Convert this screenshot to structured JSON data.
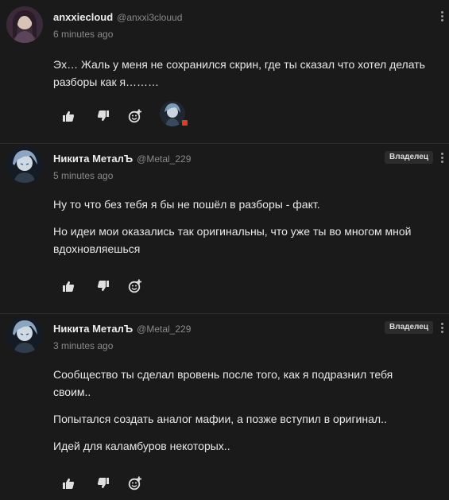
{
  "comments": [
    {
      "author": "anxxiecloud",
      "handle": "@anxxi3clouud",
      "time": "6 minutes ago",
      "badge": "",
      "paragraphs": [
        "Эх… Жаль у меня не сохранился скрин, где ты сказал что хотел делать разборы как я………"
      ]
    },
    {
      "author": "Никита МеталЪ",
      "handle": "@Metal_229",
      "time": "5 minutes ago",
      "badge": "Владелец",
      "paragraphs": [
        "Ну то что без тебя я бы не пошёл в разборы - факт.",
        "Но идеи мои оказались так оригинальны, что уже ты во многом мной вдохновляешься"
      ]
    },
    {
      "author": "Никита МеталЪ",
      "handle": "@Metal_229",
      "time": "3 minutes ago",
      "badge": "Владелец",
      "paragraphs": [
        "Сообщество ты сделал вровень после того, как я подразнил тебя своим..",
        "Попытался создать аналог мафии, а позже вступил в оригинал..",
        "Идей для каламбуров некоторых.."
      ]
    }
  ],
  "icons": {
    "like": "thumbs-up-icon",
    "dislike": "thumbs-down-icon",
    "add_reaction": "add-emoji-icon",
    "more": "more-vertical-icon"
  },
  "colors": {
    "background": "#1a1a1a",
    "text": "#e8e8e8",
    "muted": "#8a8a8a",
    "badge_bg": "#2c2c2c",
    "reaction_dot": "#e33b1f"
  }
}
